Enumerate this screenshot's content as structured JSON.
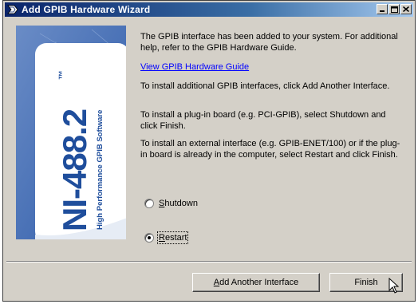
{
  "window": {
    "title": "Add GPIB Hardware Wizard",
    "titlebar_buttons": [
      "minimize-icon",
      "maximize-icon",
      "close-icon"
    ]
  },
  "banner": {
    "product": "NI-488.2",
    "trademark": "™",
    "tagline": "High Performance GPIB Software"
  },
  "content": {
    "intro": "The GPIB interface has been added to your system. For additional help, refer to the GPIB Hardware Guide.",
    "guide_link": "View GPIB Hardware Guide",
    "para_add_another": "To install additional GPIB interfaces, click Add Another Interface.",
    "para_plugin": "To install a plug-in board (e.g. PCI-GPIB), select Shutdown and click Finish.",
    "para_external": "To install an external interface (e.g. GPIB-ENET/100) or if the plug-in board is already in the computer, select Restart and click Finish."
  },
  "options": {
    "shutdown": {
      "label_accel": "S",
      "label_rest": "hutdown",
      "checked": false
    },
    "restart": {
      "label_accel": "R",
      "label_rest": "estart",
      "checked": true
    }
  },
  "buttons": {
    "add_another_accel": "A",
    "add_another_rest": "dd Another Interface",
    "finish": "Finish"
  },
  "colors": {
    "title_start": "#0a246a",
    "title_end": "#a6caf0",
    "face": "#d4d0c8",
    "link": "#0000ff",
    "banner_blue": "#1f4e9c"
  }
}
